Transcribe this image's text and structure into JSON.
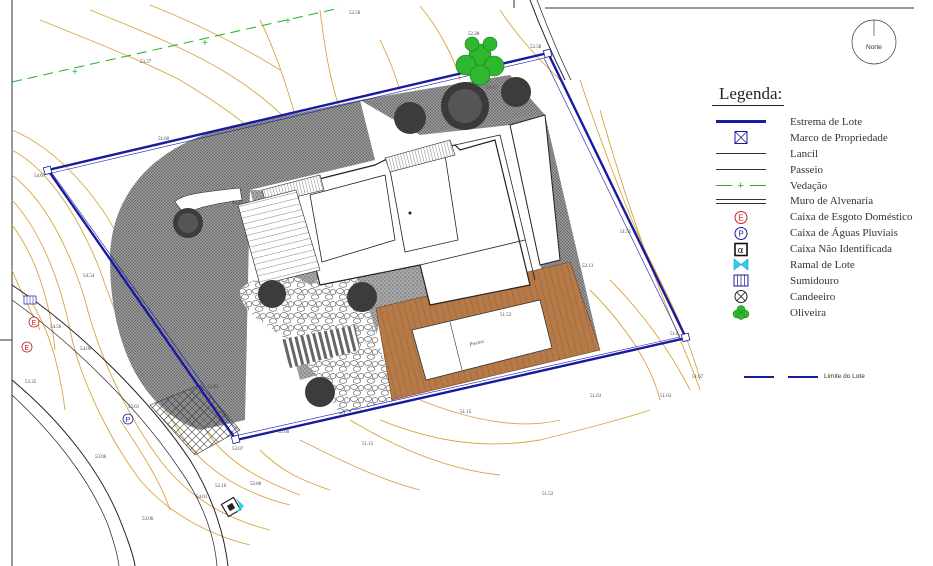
{
  "north": {
    "label": "Norte"
  },
  "legend": {
    "title": "Legenda:",
    "items": [
      {
        "label": "Estrema de Lote",
        "symbol": "thick-blue-line-icon"
      },
      {
        "label": "Marco de Propriedade",
        "symbol": "boxed-x-icon"
      },
      {
        "label": "Lancil",
        "symbol": "thin-line-icon"
      },
      {
        "label": "Passeio",
        "symbol": "thin-line-icon"
      },
      {
        "label": "Vedação",
        "symbol": "green-dashed-plus-icon"
      },
      {
        "label": "Muro de Alvenaria",
        "symbol": "double-line-icon"
      },
      {
        "label": "Caixa de Esgoto Doméstico",
        "symbol": "circle-e-icon"
      },
      {
        "label": "Caixa de Águas Pluviais",
        "symbol": "circle-p-icon"
      },
      {
        "label": "Caixa Não Identificada",
        "symbol": "boxed-alpha-icon"
      },
      {
        "label": "Ramal de Lote",
        "symbol": "cyan-bowtie-icon"
      },
      {
        "label": "Sumidouro",
        "symbol": "hatched-box-icon"
      },
      {
        "label": "Candeeiro",
        "symbol": "circle-x-icon"
      },
      {
        "label": "Oliveira",
        "symbol": "green-tree-icon"
      }
    ]
  },
  "lot_limit_label": "Limite do Lote",
  "pool_label": "Piscina",
  "elevations": [
    "52.50",
    "53.27",
    "52.28",
    "52.58",
    "53.17",
    "51.60",
    "54.67",
    "53.27",
    "54.54",
    "54.56",
    "54.00",
    "53.35",
    "52.03",
    "53.61",
    "53.06",
    "54.01",
    "52.86",
    "53.07",
    "52.60",
    "51.15",
    "51.63",
    "51.52",
    "51.15",
    "51.63",
    "51.67",
    "51.55",
    "52.13",
    "51.53",
    "51.6",
    "53.06",
    "52.16"
  ],
  "colors": {
    "lot_line": "#1a1aa0",
    "contour": "#d9a441",
    "hedge": "#22b022",
    "deck": "#b57a48",
    "paving": "#8a8a8a",
    "tree": "#444444",
    "oliveira": "#2fb82f"
  }
}
